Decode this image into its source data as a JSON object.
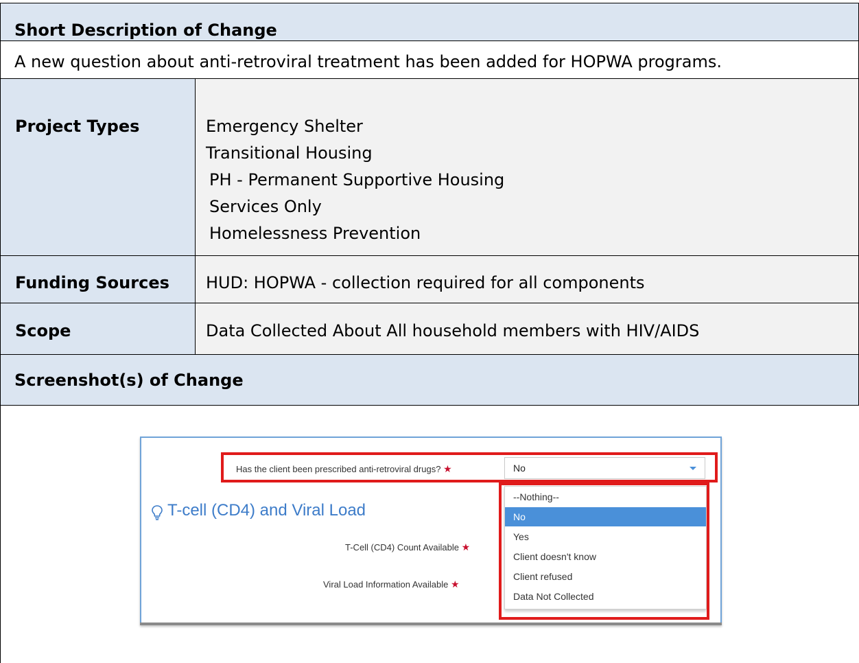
{
  "sections": {
    "short_description_title": "Short Description of Change",
    "short_description_text": "A new question about anti-retroviral treatment has been added for HOPWA programs.",
    "screenshot_title": "Screenshot(s) of Change"
  },
  "table": {
    "project_types_label": "Project Types",
    "project_types": [
      "Emergency Shelter",
      "Transitional Housing",
      "PH - Permanent Supportive Housing",
      "Services Only",
      "Homelessness Prevention"
    ],
    "funding_sources_label": "Funding Sources",
    "funding_sources_value": "HUD: HOPWA - collection required for all components",
    "scope_label": "Scope",
    "scope_value": "Data Collected About All household members with HIV/AIDS"
  },
  "screenshot": {
    "question_label": "Has the client been prescribed anti-retroviral drugs?",
    "required_marker": "★",
    "selected_value": "No",
    "section_heading": "T-cell (CD4) and Viral Load",
    "tcell_label": "T-Cell (CD4) Count Available",
    "viral_label": "Viral Load Information Available",
    "options": [
      "--Nothing--",
      "No",
      "Yes",
      "Client doesn't know",
      "Client refused",
      "Data Not Collected"
    ],
    "selected_option_index": 1,
    "accent_color": "#4a90d9",
    "highlight_color": "#e01b1b",
    "icons": [
      "lightbulb-icon",
      "chevron-down-icon",
      "required-star-icon"
    ]
  }
}
